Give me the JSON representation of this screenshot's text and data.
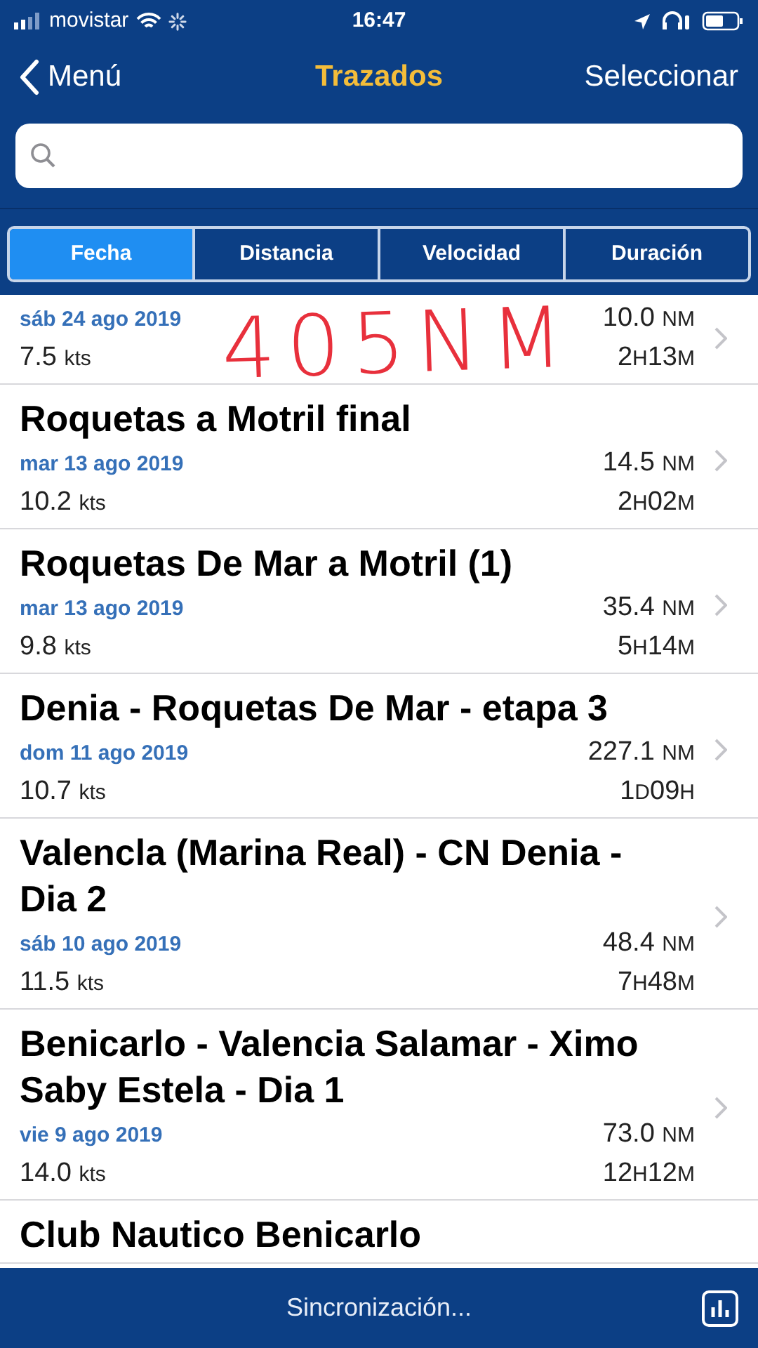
{
  "status_bar": {
    "carrier": "movistar",
    "time": "16:47"
  },
  "nav": {
    "back": "Menú",
    "title": "Trazados",
    "action": "Seleccionar"
  },
  "sort_tabs": [
    {
      "label": "Fecha",
      "selected": true
    },
    {
      "label": "Distancia",
      "selected": false
    },
    {
      "label": "Velocidad",
      "selected": false
    },
    {
      "label": "Duración",
      "selected": false
    }
  ],
  "tracks": [
    {
      "date": "sáb 24 ago 2019",
      "speed": "7.5 kts",
      "distance": "10.0 NM",
      "duration": "2H13M"
    },
    {
      "title": "Roquetas a Motril final",
      "date": "mar 13 ago 2019",
      "speed": "10.2 kts",
      "distance": "14.5 NM",
      "duration": "2H02M"
    },
    {
      "title": "Roquetas De Mar a Motril (1)",
      "date": "mar 13 ago 2019",
      "speed": "9.8 kts",
      "distance": "35.4 NM",
      "duration": "5H14M"
    },
    {
      "title": "Denia - Roquetas De Mar - etapa 3",
      "date": "dom 11 ago 2019",
      "speed": "10.7 kts",
      "distance": "227.1 NM",
      "duration": "1D09H"
    },
    {
      "title": "Valencla (Marina Real) - CN Denia - Dia 2",
      "date": "sáb 10 ago 2019",
      "speed": "11.5 kts",
      "distance": "48.4 NM",
      "duration": "7H48M"
    },
    {
      "title": "Benicarlo - Valencia Salamar - Ximo Saby Estela - Dia 1",
      "date": "vie 9 ago 2019",
      "speed": "14.0 kts",
      "distance": "73.0 NM",
      "duration": "12H12M"
    },
    {
      "title": "Club Nautico Benicarlo"
    }
  ],
  "annotation": {
    "text": "405NM"
  },
  "bottom_bar": {
    "status": "Sincronización..."
  }
}
